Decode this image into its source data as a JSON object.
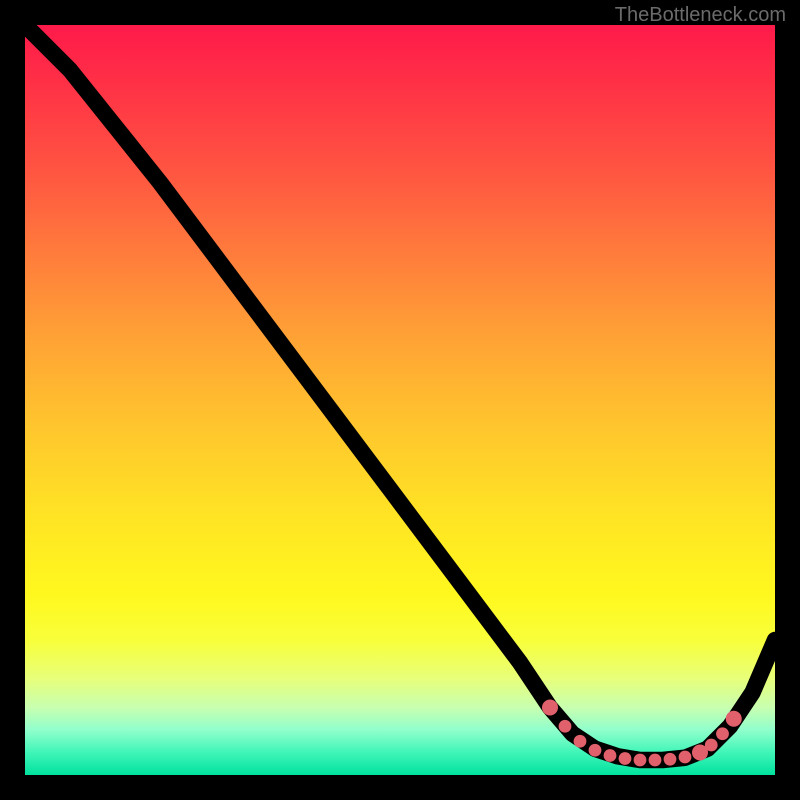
{
  "watermark": "TheBottleneck.com",
  "chart_data": {
    "type": "line",
    "title": "",
    "xlabel": "",
    "ylabel": "",
    "xlim": [
      0,
      100
    ],
    "ylim": [
      0,
      100
    ],
    "grid": false,
    "legend": false,
    "series": [
      {
        "name": "curve",
        "x": [
          0,
          6,
          12,
          18,
          24,
          30,
          36,
          42,
          48,
          54,
          60,
          66,
          70,
          73,
          76,
          79,
          82,
          85,
          88,
          91,
          94,
          97,
          100
        ],
        "y": [
          100,
          94,
          86.5,
          79,
          71,
          63,
          55,
          47,
          39,
          31,
          23,
          15,
          9,
          5.5,
          3.5,
          2.5,
          2,
          2,
          2.3,
          3.5,
          6.5,
          11,
          18
        ]
      }
    ],
    "markers": {
      "name": "highlight-dots",
      "color": "#e0606b",
      "points": [
        {
          "x": 70,
          "y": 9,
          "r": 5
        },
        {
          "x": 72,
          "y": 6.5,
          "r": 4
        },
        {
          "x": 74,
          "y": 4.5,
          "r": 4
        },
        {
          "x": 76,
          "y": 3.3,
          "r": 4
        },
        {
          "x": 78,
          "y": 2.6,
          "r": 4
        },
        {
          "x": 80,
          "y": 2.2,
          "r": 4
        },
        {
          "x": 82,
          "y": 2.0,
          "r": 4
        },
        {
          "x": 84,
          "y": 2.0,
          "r": 4
        },
        {
          "x": 86,
          "y": 2.1,
          "r": 4
        },
        {
          "x": 88,
          "y": 2.4,
          "r": 4
        },
        {
          "x": 90,
          "y": 3.0,
          "r": 5
        },
        {
          "x": 91.5,
          "y": 4.0,
          "r": 4
        },
        {
          "x": 93,
          "y": 5.5,
          "r": 4
        },
        {
          "x": 94.5,
          "y": 7.5,
          "r": 5
        }
      ]
    },
    "colors": {
      "gradient_top": "#ff1a4a",
      "gradient_mid": "#ffe524",
      "gradient_bottom": "#00e29e",
      "curve": "#000000",
      "dots": "#e0606b",
      "frame_bg": "#000000"
    }
  }
}
